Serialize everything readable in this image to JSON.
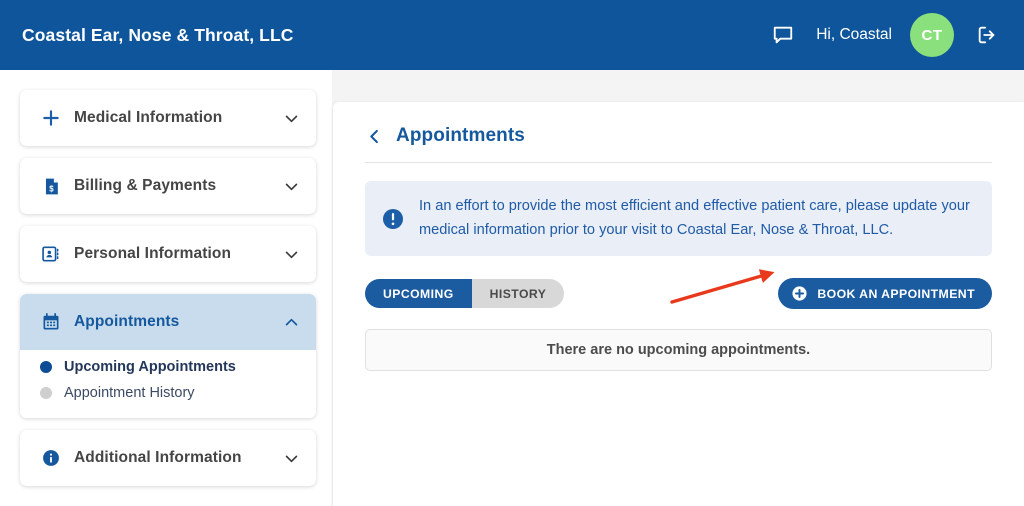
{
  "header": {
    "brand": "Coastal Ear, Nose & Throat, LLC",
    "greeting": "Hi, Coastal",
    "avatar_initials": "CT",
    "messages_icon": "speech-bubble-icon",
    "logout_icon": "logout-icon",
    "background_color": "#0e559b",
    "avatar_color": "#8ae07c"
  },
  "sidebar": {
    "items": [
      {
        "label": "Medical Information",
        "icon": "plus-icon",
        "expanded": false,
        "active": false
      },
      {
        "label": "Billing & Payments",
        "icon": "invoice-dollar-icon",
        "expanded": false,
        "active": false
      },
      {
        "label": "Personal Information",
        "icon": "contact-card-icon",
        "expanded": false,
        "active": false
      },
      {
        "label": "Appointments",
        "icon": "calendar-icon",
        "expanded": true,
        "active": true,
        "subitems": [
          {
            "label": "Upcoming Appointments",
            "selected": true
          },
          {
            "label": "Appointment History",
            "selected": false
          }
        ]
      },
      {
        "label": "Additional Information",
        "icon": "info-circle-icon",
        "expanded": false,
        "active": false
      }
    ],
    "active_background_color": "#c8dced",
    "active_text_color": "#15589e"
  },
  "main": {
    "back_icon": "chevron-left-icon",
    "title": "Appointments",
    "banner": {
      "icon": "exclamation-circle-icon",
      "text": "In an effort to provide the most efficient and effective patient care, please update your medical information prior to your visit to Coastal Ear, Nose & Throat, LLC.",
      "background_color": "#e9eef7",
      "text_color": "#1f5ba6"
    },
    "tabs": [
      {
        "label": "UPCOMING",
        "active": true
      },
      {
        "label": "HISTORY",
        "active": false
      }
    ],
    "book_button": {
      "label": "BOOK AN APPOINTMENT",
      "icon": "plus-circle-icon",
      "color": "#1b5ba0"
    },
    "empty_state": "There are no upcoming appointments."
  },
  "annotation": {
    "arrow_color": "#e8391c",
    "arrow_from": "672,302",
    "arrow_to": "777,271"
  }
}
